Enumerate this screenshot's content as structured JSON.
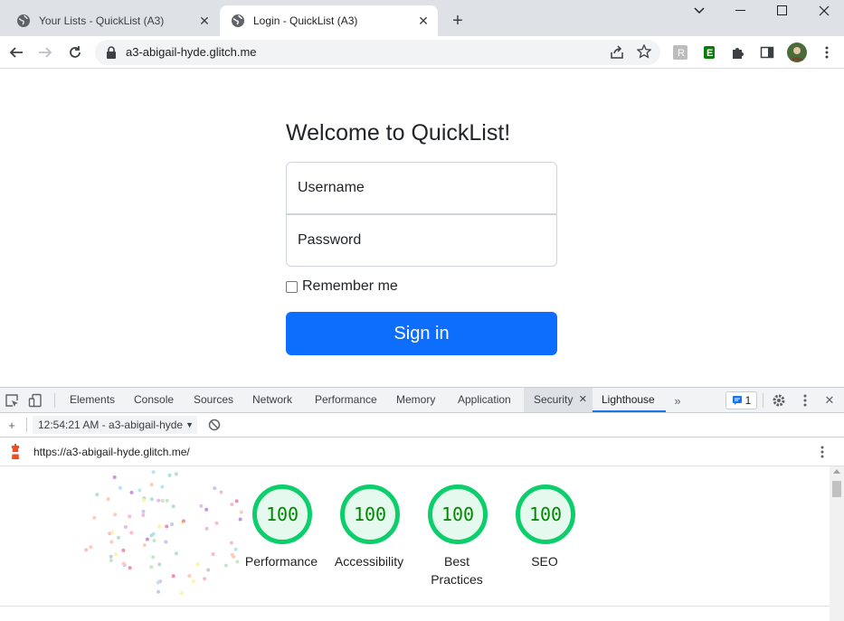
{
  "browser": {
    "tabs": [
      {
        "title": "Your Lists - QuickList (A3)",
        "active": false
      },
      {
        "title": "Login - QuickList (A3)",
        "active": true
      }
    ],
    "address": "a3-abigail-hyde.glitch.me"
  },
  "page": {
    "heading": "Welcome to QuickList!",
    "username_placeholder": "Username",
    "password_placeholder": "Password",
    "remember_label": "Remember me",
    "signin_label": "Sign in"
  },
  "devtools": {
    "tabs": [
      "Elements",
      "Console",
      "Sources",
      "Network",
      "Performance",
      "Memory",
      "Application",
      "Security",
      "Lighthouse"
    ],
    "selected_tab": "Lighthouse",
    "issues_count": "1",
    "report_selector": "12:54:21 AM - a3-abigail-hyde",
    "report_url": "https://a3-abigail-hyde.glitch.me/",
    "scores": [
      {
        "value": "100",
        "label": "Performance"
      },
      {
        "value": "100",
        "label": "Accessibility"
      },
      {
        "value": "100",
        "label": "Best\nPractices"
      },
      {
        "value": "100",
        "label": "SEO"
      }
    ],
    "score_color": "#0cce6b"
  }
}
